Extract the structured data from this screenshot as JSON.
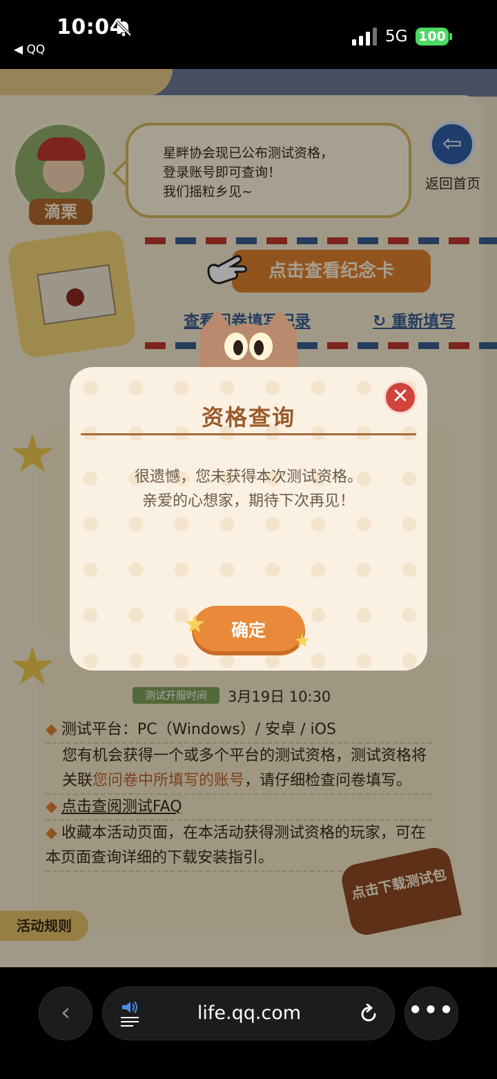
{
  "status_bar": {
    "time": "10:04",
    "back_app": "◀ QQ",
    "network": "5G",
    "battery": "100"
  },
  "page": {
    "character_name": "滴栗",
    "speech_lines": [
      "星畔协会现已公布测试资格，",
      "登录账号即可查询！",
      "我们摇粒乡见~"
    ],
    "home_label": "返回首页",
    "view_card_button": "点击查看纪念卡",
    "record_link": "查看问卷填写记录",
    "refill_link": "重新填写",
    "server_time_tag": "测试开服时间",
    "server_time_value": "3月19日  10:30",
    "info": {
      "platform": "测试平台：PC（Windows）/ 安卓 / iOS",
      "note_a": "您有机会获得一个或多个平台的测试资格，测试资格将关联",
      "note_highlight": "您问卷中所填写的账号",
      "note_b": "，请仔细检查问卷填写。",
      "faq_link": "点击查阅测试FAQ",
      "bookmark": "收藏本活动页面，在本活动获得测试资格的玩家，可在本页面查询详细的下载安装指引。"
    },
    "download_badge": "点击下载测试包",
    "rules_tag": "活动规则"
  },
  "modal": {
    "title": "资格查询",
    "message_line1": "很遗憾，您未获得本次测试资格。",
    "message_line2": "亲爱的心想家，期待下次再见！",
    "confirm": "确定",
    "close_symbol": "✕"
  },
  "browser": {
    "url": "life.qq.com",
    "back_symbol": "‹",
    "more_symbol": "•••"
  },
  "colors": {
    "accent_orange": "#e88a3a",
    "title_brown": "#9b5a2b",
    "close_red": "#d0433a",
    "battery_green": "#4cd964"
  }
}
